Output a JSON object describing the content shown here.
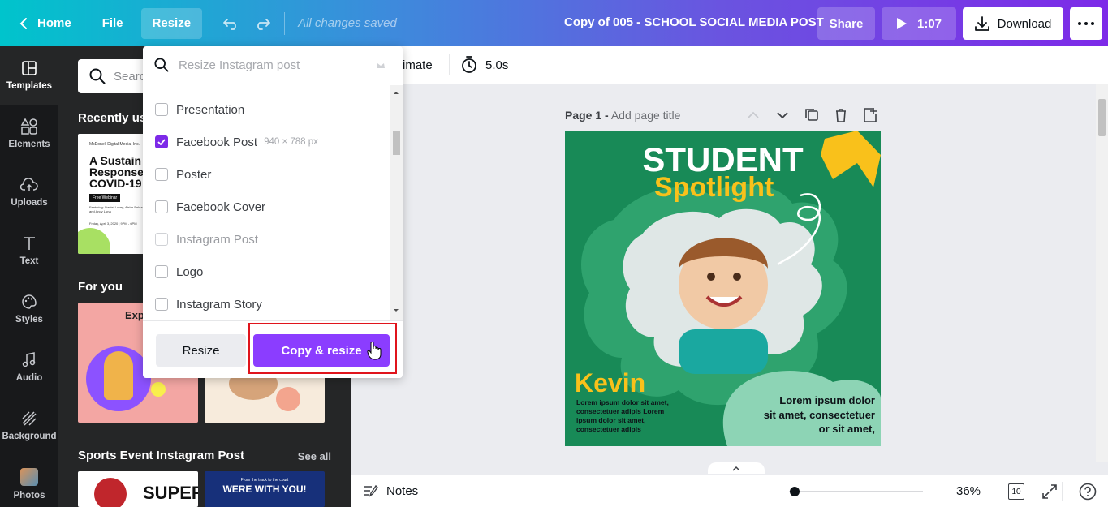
{
  "topbar": {
    "home": "Home",
    "file": "File",
    "resize": "Resize",
    "saved_status": "All changes saved",
    "doc_title": "Copy of 005 - SCHOOL SOCIAL MEDIA POST",
    "share": "Share",
    "play_time": "1:07",
    "download": "Download"
  },
  "rail": {
    "items": [
      {
        "label": "Templates",
        "icon": "templates-icon"
      },
      {
        "label": "Elements",
        "icon": "elements-icon"
      },
      {
        "label": "Uploads",
        "icon": "upload-icon"
      },
      {
        "label": "Text",
        "icon": "text-icon"
      },
      {
        "label": "Styles",
        "icon": "palette-icon"
      },
      {
        "label": "Audio",
        "icon": "music-note-icon"
      },
      {
        "label": "Background",
        "icon": "background-icon"
      },
      {
        "label": "Photos",
        "icon": "photos-icon"
      }
    ]
  },
  "panel": {
    "search_placeholder": "Searc",
    "recently_used": "Recently us",
    "for_you": "For you",
    "sports_title": "Sports Event Instagram Post",
    "see_all": "See all",
    "thumb1": {
      "org": "McDonell Digital Media, Inc.",
      "title_l1": "A Sustain",
      "title_l2": "Response",
      "title_l3": "COVID-19",
      "badge": "Free Webinar",
      "featuring": "Featuring: Daniel Lucey, Aisha Salazar, and Andy Luna",
      "date": "Friday, April 3, 2020 | 9PM - 6PM"
    },
    "thumb_foryou": {
      "heading": "Exp"
    },
    "sports1": {
      "text": "SUPER"
    },
    "sports2": {
      "small": "From the track to the court",
      "big": "WERE WITH YOU!"
    }
  },
  "subbar": {
    "animate": "imate",
    "duration": "5.0s"
  },
  "dropdown": {
    "search_placeholder": "Resize Instagram post",
    "items": [
      {
        "label": "Presentation",
        "checked": false,
        "disabled": false,
        "dim": ""
      },
      {
        "label": "Facebook Post",
        "checked": true,
        "disabled": false,
        "dim": "940 × 788 px"
      },
      {
        "label": "Poster",
        "checked": false,
        "disabled": false,
        "dim": ""
      },
      {
        "label": "Facebook Cover",
        "checked": false,
        "disabled": false,
        "dim": ""
      },
      {
        "label": "Instagram Post",
        "checked": false,
        "disabled": true,
        "dim": ""
      },
      {
        "label": "Logo",
        "checked": false,
        "disabled": false,
        "dim": ""
      },
      {
        "label": "Instagram Story",
        "checked": false,
        "disabled": false,
        "dim": ""
      }
    ],
    "resize_button": "Resize",
    "copy_resize_button": "Copy & resize"
  },
  "page": {
    "label": "Page 1 -",
    "add_title": "Add page title"
  },
  "design": {
    "title": "STUDENT",
    "subtitle": "Spotlight",
    "name": "Kevin",
    "small_text": "Lorem ipsum dolor sit amet, consectetuer adipis Lorem ipsum dolor sit amet, consectetuer adipis",
    "quote_l1": "Lorem ipsum dolor",
    "quote_l2": "sit amet, consectetuer",
    "quote_l3": "or sit amet,",
    "colors": {
      "green": "#188a57",
      "light_green": "#6fc79d",
      "yellow": "#f9c11b",
      "white": "#ffffff"
    }
  },
  "bottombar": {
    "notes": "Notes",
    "zoom": "36%",
    "page_count": "10",
    "zoom_level": 0.02
  },
  "colors": {
    "accent": "#7d2ae8",
    "highlight": "#e0141c"
  }
}
